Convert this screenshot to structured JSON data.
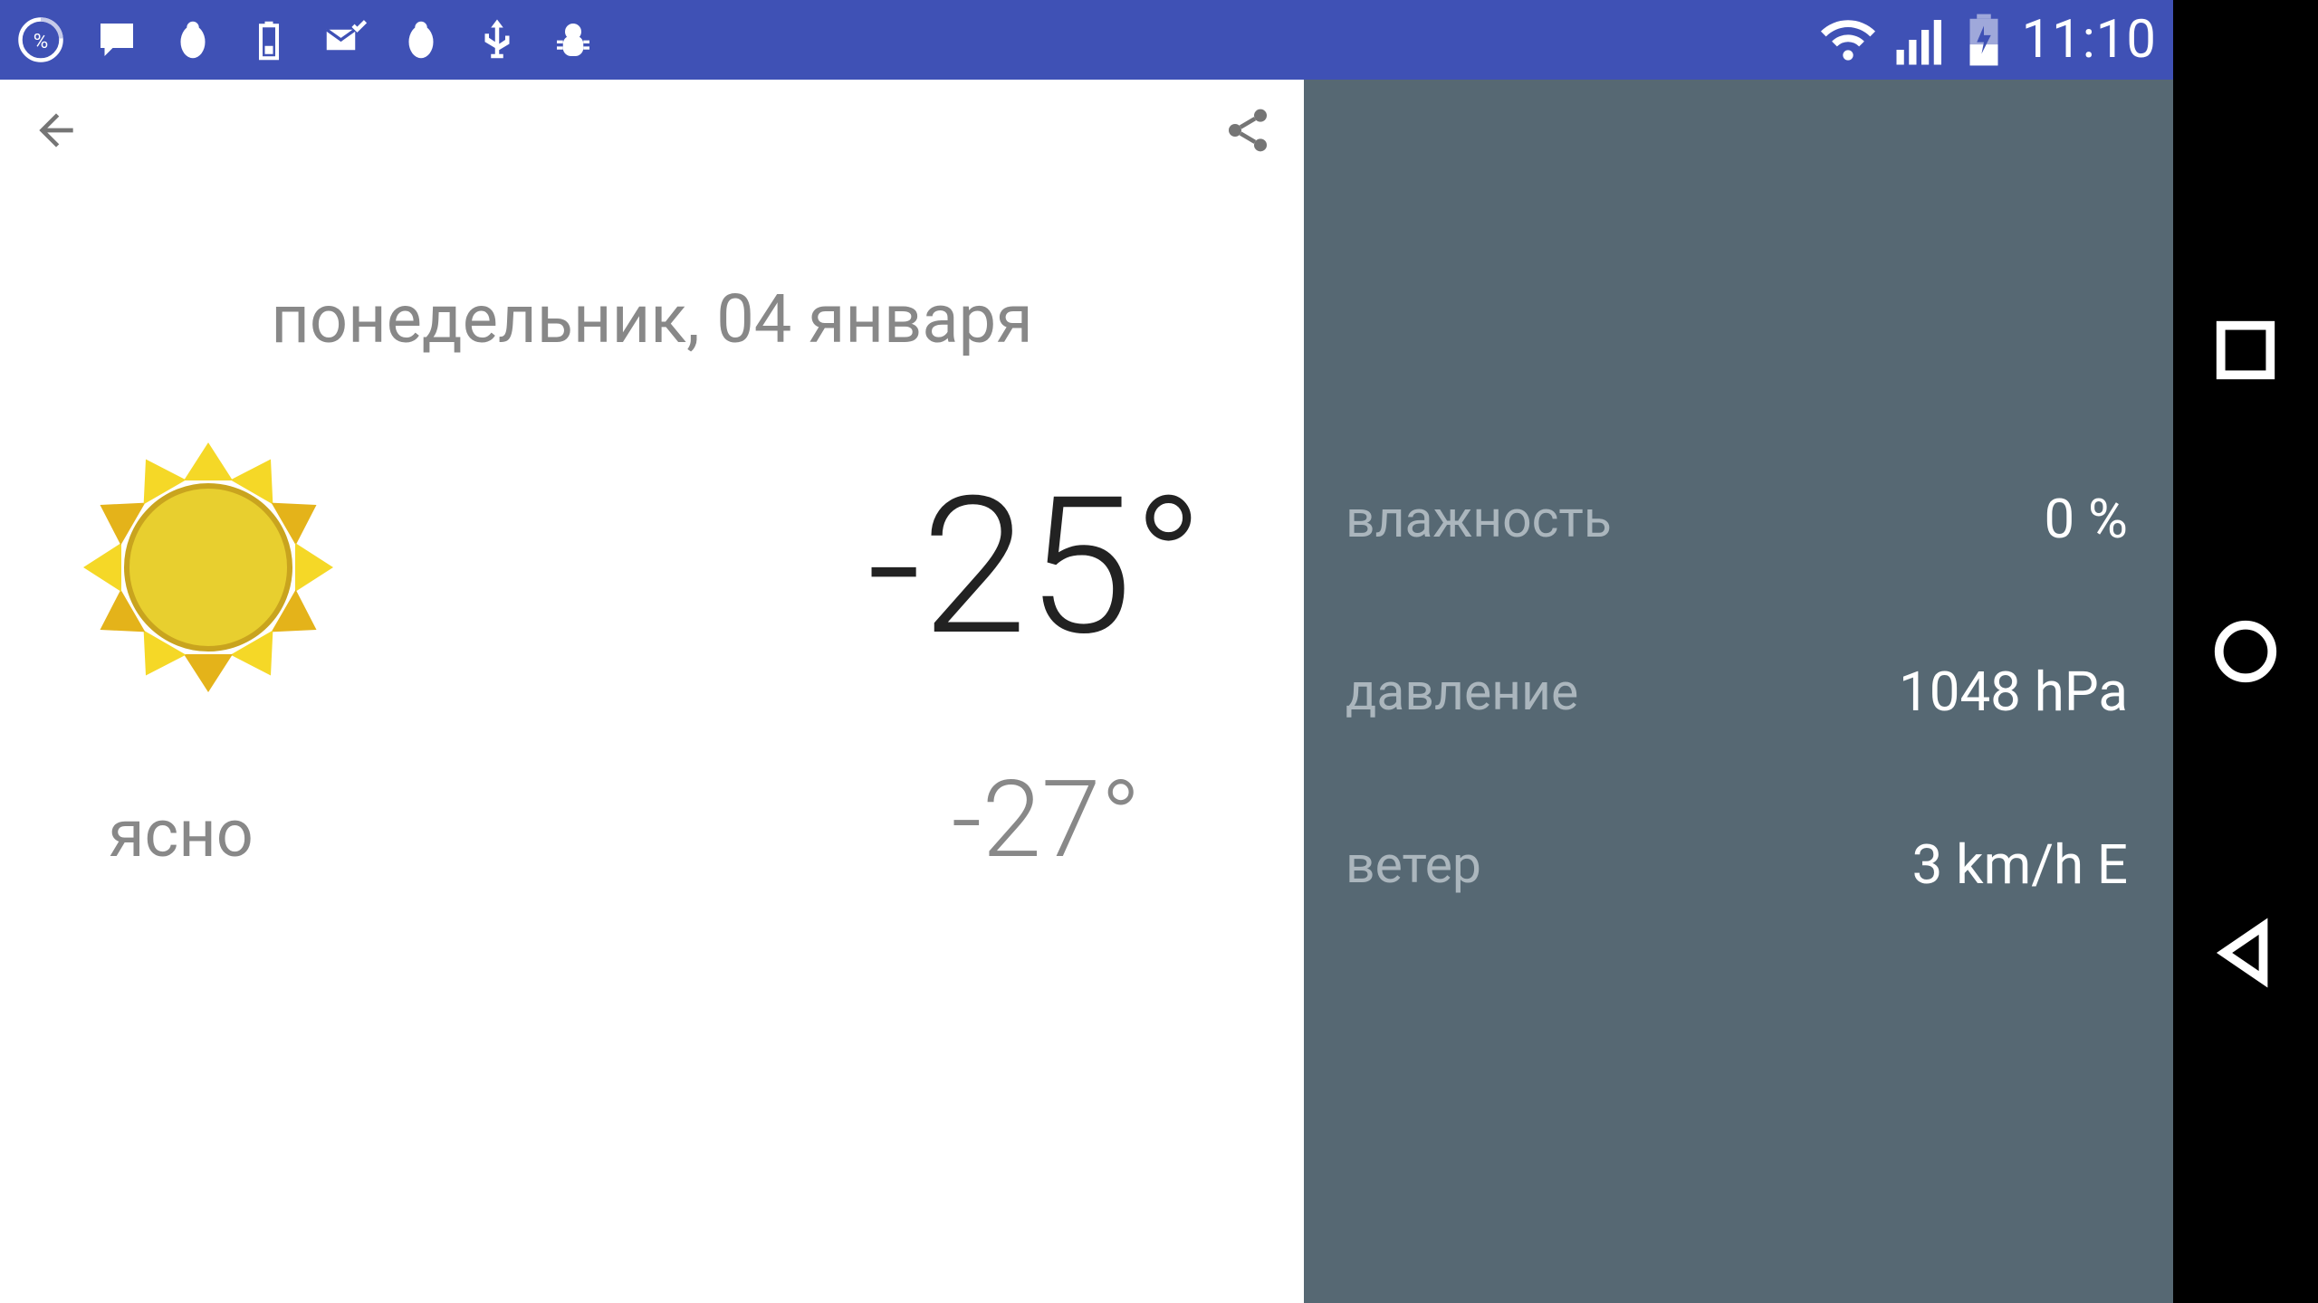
{
  "status_bar": {
    "time": "11:10"
  },
  "main": {
    "date": "понедельник, 04 января",
    "condition": "ясно",
    "temp_high": "-25°",
    "temp_low": "-27°"
  },
  "side": {
    "humidity_label": "влажность",
    "humidity_value": "0 %",
    "pressure_label": "давление",
    "pressure_value": "1048 hPa",
    "wind_label": "ветер",
    "wind_value": "3 km/h E"
  }
}
